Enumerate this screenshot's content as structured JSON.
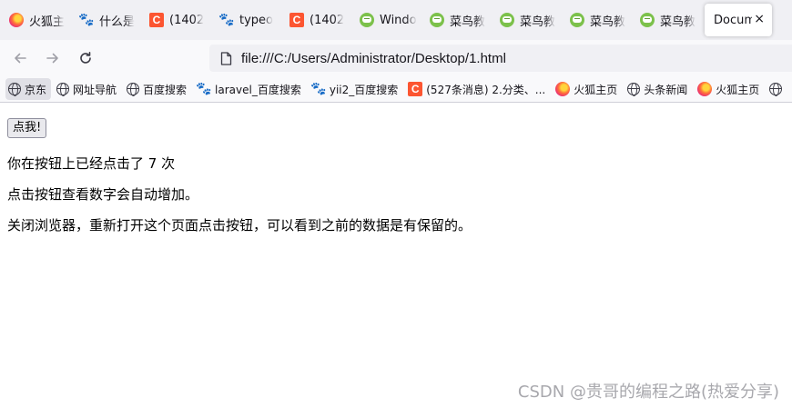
{
  "tabs": [
    {
      "title": "火狐主",
      "icon": "firefox-icon"
    },
    {
      "title": "什么是",
      "icon": "baidu-paw-icon"
    },
    {
      "title": "(1402",
      "icon": "csdn-icon"
    },
    {
      "title": "typeo",
      "icon": "baidu-paw-icon"
    },
    {
      "title": "(1402",
      "icon": "csdn-icon"
    },
    {
      "title": "Windo",
      "icon": "runoob-icon"
    },
    {
      "title": "菜鸟教",
      "icon": "runoob-icon"
    },
    {
      "title": "菜鸟教",
      "icon": "runoob-icon"
    },
    {
      "title": "菜鸟教",
      "icon": "runoob-icon"
    },
    {
      "title": "菜鸟教",
      "icon": "runoob-icon"
    }
  ],
  "active_tab": {
    "title": "Docum",
    "close": "×"
  },
  "nav": {
    "url": "file:///C:/Users/Administrator/Desktop/1.html"
  },
  "bookmarks": [
    {
      "label": "京东",
      "icon": "globe-icon"
    },
    {
      "label": "网址导航",
      "icon": "globe-icon"
    },
    {
      "label": "百度搜索",
      "icon": "globe-icon"
    },
    {
      "label": "laravel_百度搜索",
      "icon": "baidu-paw-icon"
    },
    {
      "label": "yii2_百度搜索",
      "icon": "baidu-paw-icon"
    },
    {
      "label": "(527条消息) 2.分类、...",
      "icon": "csdn-icon"
    },
    {
      "label": "火狐主页",
      "icon": "firefox-icon"
    },
    {
      "label": "头条新闻",
      "icon": "globe-icon"
    },
    {
      "label": "火狐主页",
      "icon": "firefox-icon"
    }
  ],
  "page": {
    "button_label": "点我!",
    "click_count_text": "你在按钮上已经点击了 7 次",
    "hint": "点击按钮查看数字会自动增加。",
    "note": "关闭浏览器，重新打开这个页面点击按钮，可以看到之前的数据是有保留的。"
  },
  "watermark": "CSDN @贵哥的编程之路(热爱分享)",
  "colors": {
    "tabstrip_bg": "#f0f0f4",
    "toolbar_bg": "#f9f9fb",
    "csdn_red": "#fc5531",
    "baidu_blue": "#2932e1",
    "runoob_green": "#7cc14b"
  }
}
